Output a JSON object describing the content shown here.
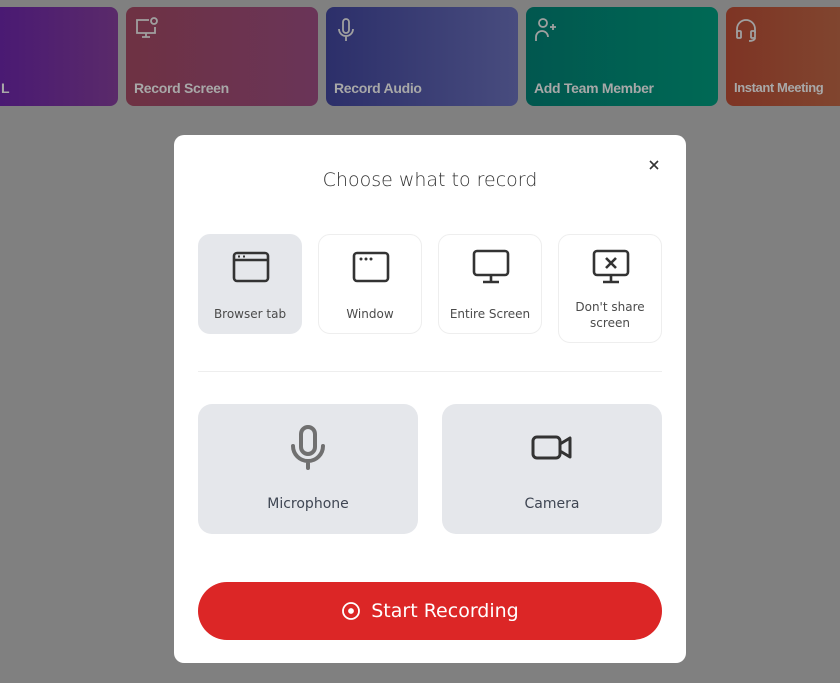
{
  "quick_actions": [
    {
      "label": "L",
      "icon": "unknown-icon",
      "color_from": "#4a1a73",
      "color_to": "#5a2a6a"
    },
    {
      "label": "Record Screen",
      "icon": "monitor-record-icon",
      "color_from": "#6e3243",
      "color_to": "#6a3458"
    },
    {
      "label": "Record Audio",
      "icon": "microphone-icon",
      "color_from": "#2c2f6a",
      "color_to": "#484c7e"
    },
    {
      "label": "Add Team Member",
      "icon": "user-plus-icon",
      "color_from": "#01574f",
      "color_to": "#006955"
    },
    {
      "label": "Instant Meeting",
      "icon": "headset-icon",
      "color_from": "#7e3424",
      "color_to": "#80452f"
    }
  ],
  "modal": {
    "title": "Choose what to record",
    "close_icon": "close-icon",
    "sources": [
      {
        "label": "Browser tab",
        "icon": "browser-tab-icon",
        "selected": true
      },
      {
        "label": "Window",
        "icon": "window-icon",
        "selected": false
      },
      {
        "label": "Entire Screen",
        "icon": "monitor-icon",
        "selected": false
      },
      {
        "label": "Don't share screen",
        "icon": "monitor-off-icon",
        "selected": false
      }
    ],
    "devices": [
      {
        "label": "Microphone",
        "icon": "microphone-icon"
      },
      {
        "label": "Camera",
        "icon": "camera-icon"
      }
    ],
    "start_label": "Start Recording",
    "accent": "#dc2626"
  }
}
